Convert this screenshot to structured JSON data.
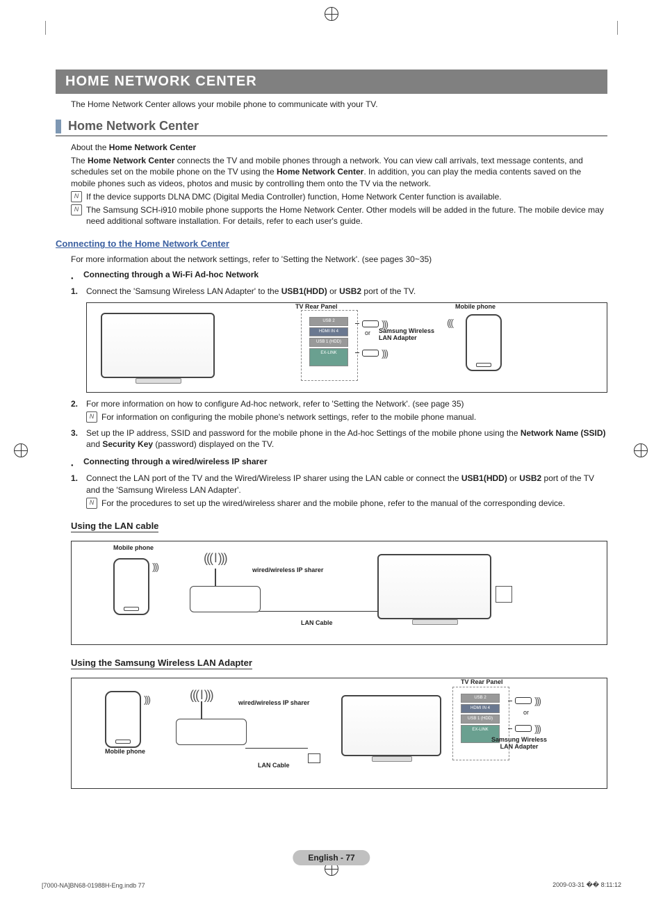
{
  "banner": "HOME NETWORK CENTER",
  "intro": "The Home Network Center allows your mobile phone to communicate with your TV.",
  "section_title": "Home Network Center",
  "about_label": "About the ",
  "about_bold": "Home Network Center",
  "p1a": "The ",
  "p1b": "Home Network Center",
  "p1c": " connects the TV and mobile phones through a network. You can view call arrivals, text message contents, and schedules set on the mobile phone on the TV using the ",
  "p1d": "Home Network Center",
  "p1e": ". In addition, you can play the media contents saved on the mobile phones such as videos, photos and music by controlling them onto the TV via the network.",
  "note1": "If the device supports DLNA DMC (Digital Media Controller) function, Home Network Center function is available.",
  "note2": "The Samsung SCH-i910 mobile phone supports the Home Network Center. Other models will be added in the future. The mobile device may need additional software installation. For details, refer to each user's guide.",
  "connect_head": "Connecting to the Home Network Center",
  "connect_intro": "For more information about the network settings, refer to 'Setting the Network'. (see pages 30~35)",
  "bul1": "Connecting through a Wi-Fi Ad-hoc Network",
  "step1a": "Connect the 'Samsung Wireless LAN Adapter' to the ",
  "step1b": "USB1(HDD)",
  "step1c": " or ",
  "step1d": "USB2",
  "step1e": " port of the TV.",
  "fig1": {
    "tv_rear": "TV Rear Panel",
    "mobile": "Mobile phone",
    "adapter": "Samsung Wireless LAN Adapter",
    "or": "or",
    "ports": {
      "usb2": "USB 2",
      "hdmi": "HDMI IN 4",
      "usb1": "USB 1 (HDD)",
      "exlink": "EX-LINK"
    }
  },
  "step2": "For more information on how to configure Ad-hoc network, refer to 'Setting the Network'. (see page 35)",
  "step2_note": "For information on configuring the mobile phone's network settings, refer to the mobile phone manual.",
  "step3a": "Set up the IP address, SSID and password for the mobile phone in the Ad-hoc Settings of the mobile phone using the ",
  "step3b": "Network Name (SSID)",
  "step3c": " and ",
  "step3d": "Security Key",
  "step3e": " (password) displayed on the TV.",
  "bul2": "Connecting through a wired/wireless IP sharer",
  "ip_step1a": "Connect the LAN port of the TV and the Wired/Wireless IP sharer using the LAN cable or connect the ",
  "ip_step1b": "USB1(HDD)",
  "ip_step1c": " or ",
  "ip_step1d": "USB2",
  "ip_step1e": " port of the TV and the 'Samsung Wireless LAN Adapter'.",
  "ip_note": "For the procedures to set up the wired/wireless sharer and the mobile phone, refer to the manual of the corresponding device.",
  "lan_head": "Using the LAN cable",
  "fig2": {
    "mobile": "Mobile phone",
    "sharer": "wired/wireless IP sharer",
    "lan": "LAN Cable"
  },
  "wlan_head": "Using the Samsung Wireless LAN Adapter",
  "fig3": {
    "mobile": "Mobile phone",
    "sharer": "wired/wireless IP sharer",
    "lan": "LAN Cable",
    "tv_rear": "TV Rear Panel",
    "or": "or",
    "adapter": "Samsung Wireless LAN Adapter"
  },
  "footer_page": "English - 77",
  "footer_left": "[7000-NA]BN68-01988H-Eng.indb   77",
  "footer_right": "2009-03-31   �� 8:11:12"
}
